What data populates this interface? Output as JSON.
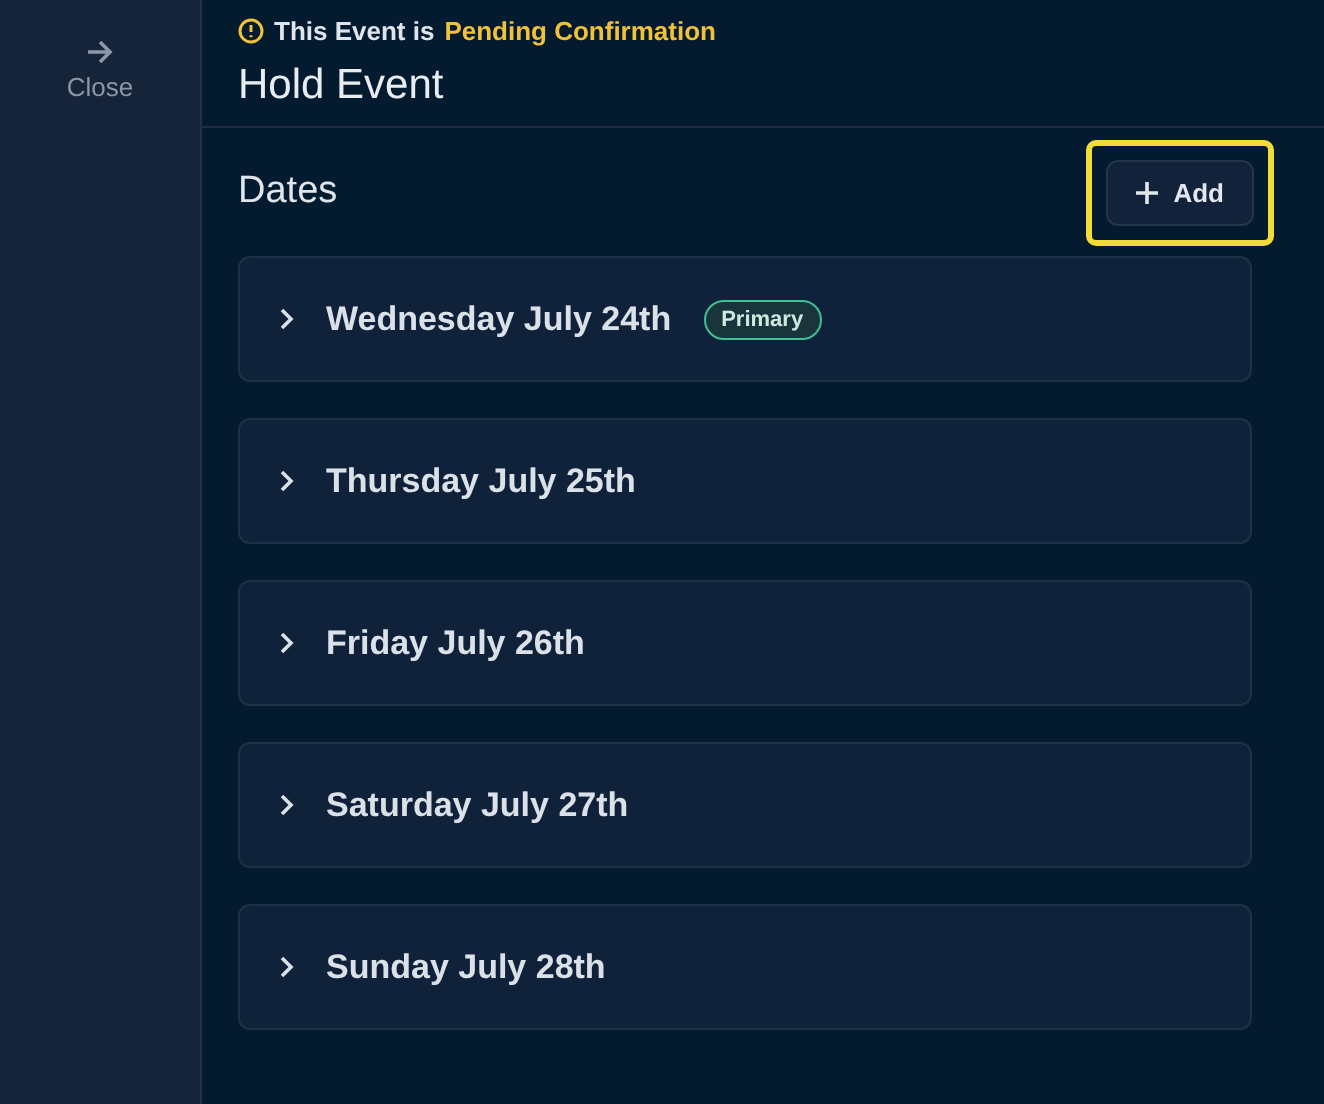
{
  "sidebar": {
    "close_label": "Close"
  },
  "status": {
    "prefix": "This Event is",
    "value": "Pending Confirmation"
  },
  "title": "Hold Event",
  "section": {
    "title": "Dates",
    "add_button": {
      "label": "Add",
      "highlighted": true
    }
  },
  "dates": [
    {
      "label": "Wednesday July 24th",
      "badge": "Primary",
      "expanded": false
    },
    {
      "label": "Thursday July 25th",
      "expanded": false
    },
    {
      "label": "Friday July 26th",
      "expanded": false
    },
    {
      "label": "Saturday July 27th",
      "expanded": false
    },
    {
      "label": "Sunday July 28th",
      "expanded": false
    }
  ]
}
